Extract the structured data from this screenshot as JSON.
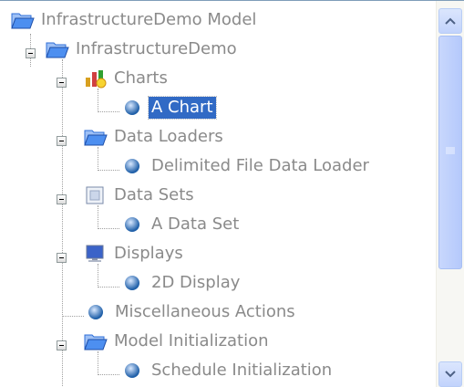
{
  "tree": {
    "items": [
      {
        "id": "root",
        "label": "InfrastructureDemo Model",
        "icon": "folder-open-icon",
        "level": 0
      },
      {
        "id": "infra",
        "label": "InfrastructureDemo",
        "icon": "folder-open-icon",
        "level": 1
      },
      {
        "id": "charts",
        "label": "Charts",
        "icon": "charts-icon",
        "level": 2
      },
      {
        "id": "chart",
        "label": "A Chart",
        "icon": "blue-dot-icon",
        "level": 3,
        "selected": true
      },
      {
        "id": "loaders",
        "label": "Data Loaders",
        "icon": "folder-open-icon",
        "level": 2
      },
      {
        "id": "loader",
        "label": "Delimited File Data Loader",
        "icon": "blue-dot-icon",
        "level": 3
      },
      {
        "id": "datasets",
        "label": "Data Sets",
        "icon": "dataset-icon",
        "level": 2
      },
      {
        "id": "dataset",
        "label": "A Data Set",
        "icon": "blue-dot-icon",
        "level": 3
      },
      {
        "id": "displays",
        "label": "Displays",
        "icon": "monitor-icon",
        "level": 2
      },
      {
        "id": "display",
        "label": "2D Display",
        "icon": "blue-dot-icon",
        "level": 3
      },
      {
        "id": "misc",
        "label": "Miscellaneous Actions",
        "icon": "blue-dot-icon",
        "level": 2
      },
      {
        "id": "init",
        "label": "Model Initialization",
        "icon": "folder-open-icon",
        "level": 2
      },
      {
        "id": "sched",
        "label": "Schedule Initialization",
        "icon": "blue-dot-icon",
        "level": 3
      }
    ]
  },
  "colors": {
    "selection": "#316ac5",
    "label": "#8a8a8a",
    "folder": "#2f6fd8",
    "dot": "#1f5fa8"
  }
}
